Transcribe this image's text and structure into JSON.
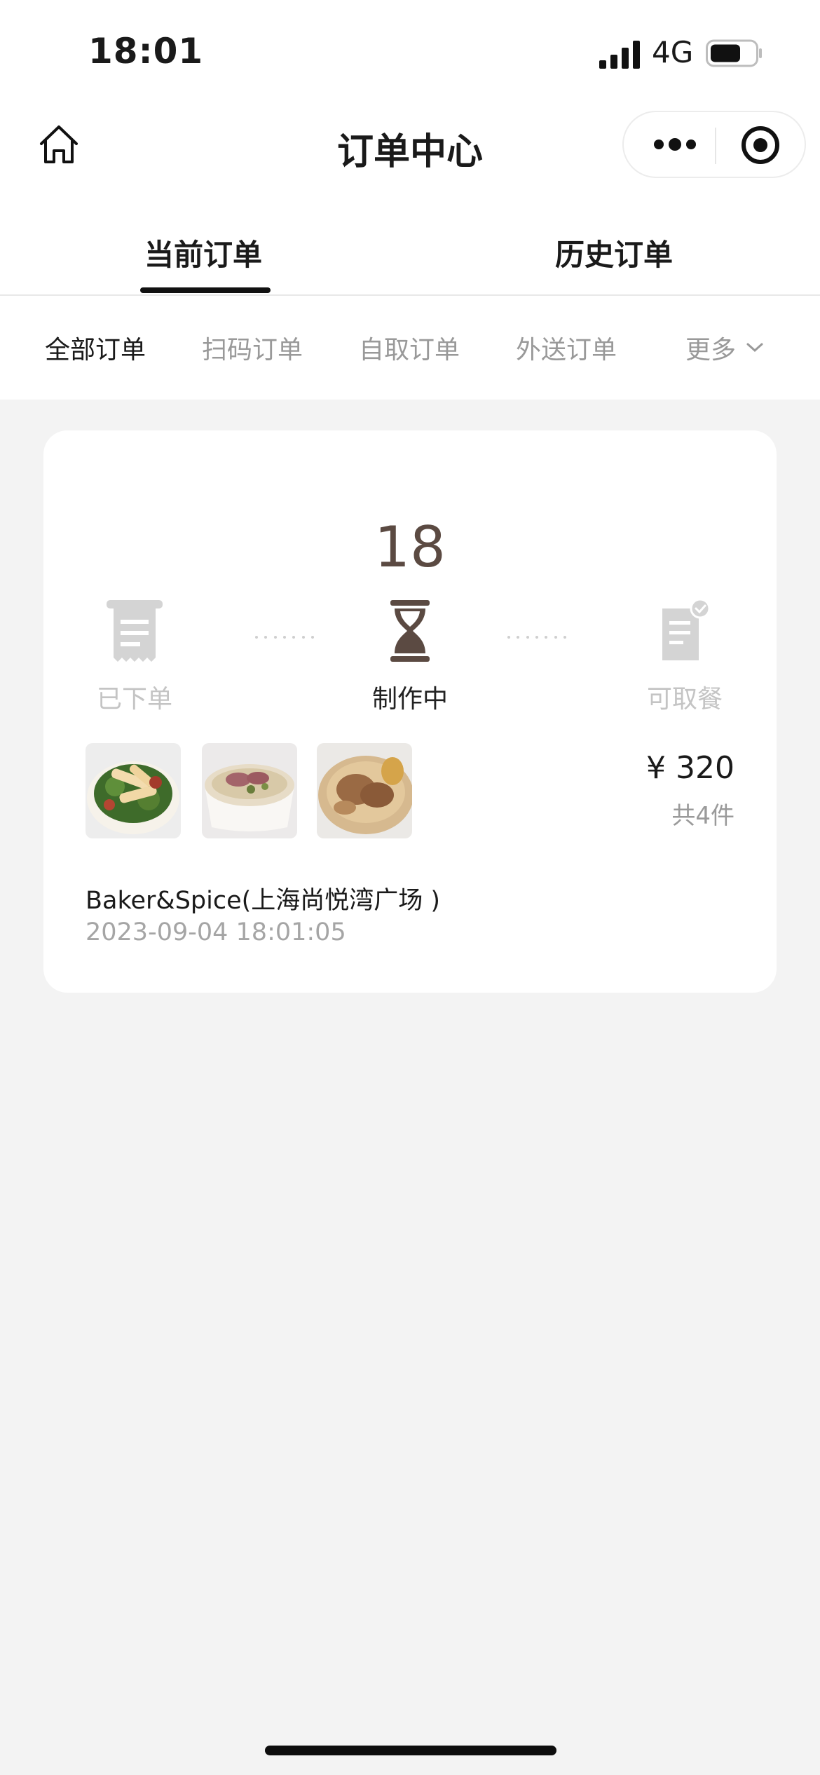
{
  "status_bar": {
    "time": "18:01",
    "network": "4G",
    "icons": [
      "signal-icon",
      "battery-icon"
    ]
  },
  "nav": {
    "title": "订单中心",
    "home_icon": "home-icon",
    "more_icon": "more-dots-icon",
    "close_icon": "target-close-icon"
  },
  "main_tabs": [
    {
      "label": "当前订单",
      "active": true
    },
    {
      "label": "历史订单",
      "active": false
    }
  ],
  "filters": [
    {
      "label": "全部订单",
      "active": true
    },
    {
      "label": "扫码订单",
      "active": false
    },
    {
      "label": "自取订单",
      "active": false
    },
    {
      "label": "外送订单",
      "active": false
    },
    {
      "label": "更多",
      "active": false,
      "icon": "chevron-down-icon"
    }
  ],
  "order": {
    "queue_number": "18",
    "steps": [
      {
        "label": "已下单",
        "icon": "receipt-icon",
        "active": false
      },
      {
        "label": "制作中",
        "icon": "hourglass-icon",
        "active": true
      },
      {
        "label": "可取餐",
        "icon": "document-check-icon",
        "active": false
      }
    ],
    "items": [
      {
        "icon": "food-salad-image"
      },
      {
        "icon": "food-noodle-image"
      },
      {
        "icon": "food-chicken-image"
      }
    ],
    "price": "¥ 320",
    "count": "共4件",
    "store": "Baker&Spice(上海尚悦湾广场 )",
    "time": "2023-09-04 18:01:05"
  },
  "colors": {
    "background": "#f3f3f3",
    "card": "#ffffff",
    "accent_brown": "#5b4a42",
    "inactive_gray": "#c4c4c4"
  }
}
